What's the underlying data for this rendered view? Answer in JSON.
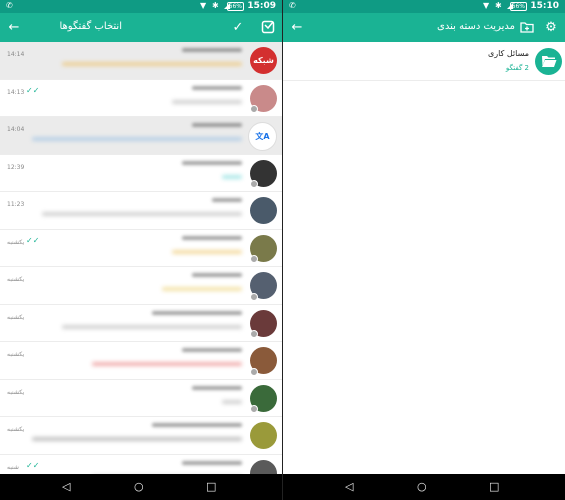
{
  "left_screen": {
    "status": {
      "time": "15:09",
      "battery": "66%"
    },
    "appbar": {
      "title": "انتخاب گفتگوها"
    },
    "rows": [
      {
        "time": "14:14",
        "ticks": "",
        "selected": true,
        "avatar_color": "#d32f2f",
        "avatar_text": "شبکه",
        "w1": 60,
        "w2": 180,
        "dot": false,
        "c2": "#f0b030"
      },
      {
        "time": "14:13",
        "ticks": "✓✓",
        "selected": false,
        "avatar_color": "#c98a8a",
        "avatar_text": "",
        "w1": 50,
        "w2": 70,
        "dot": true,
        "c2": "#999"
      },
      {
        "time": "14:04",
        "ticks": "",
        "selected": true,
        "avatar_color": "#ffffff",
        "avatar_text": "文A",
        "w1": 50,
        "w2": 210,
        "dot": false,
        "c2": "#7ab0e0"
      },
      {
        "time": "12:39",
        "ticks": "",
        "selected": false,
        "avatar_color": "#333333",
        "avatar_text": "",
        "w1": 60,
        "w2": 20,
        "dot": true,
        "c2": "#4cc"
      },
      {
        "time": "11:23",
        "ticks": "",
        "selected": false,
        "avatar_color": "#4a5a6a",
        "avatar_text": "",
        "w1": 30,
        "w2": 200,
        "dot": false,
        "c2": "#999"
      },
      {
        "time": "یکشنبه",
        "ticks": "✓✓",
        "selected": false,
        "avatar_color": "#7a7a4a",
        "avatar_text": "",
        "w1": 60,
        "w2": 70,
        "dot": true,
        "c2": "#e6b030"
      },
      {
        "time": "یکشنبه",
        "ticks": "",
        "selected": false,
        "avatar_color": "#556070",
        "avatar_text": "",
        "w1": 50,
        "w2": 80,
        "dot": true,
        "c2": "#e6c040"
      },
      {
        "time": "یکشنبه",
        "ticks": "",
        "selected": false,
        "avatar_color": "#6a3a3a",
        "avatar_text": "",
        "w1": 90,
        "w2": 180,
        "dot": true,
        "c2": "#999"
      },
      {
        "time": "یکشنبه",
        "ticks": "",
        "selected": false,
        "avatar_color": "#8a5a3a",
        "avatar_text": "",
        "w1": 60,
        "w2": 150,
        "dot": true,
        "c2": "#e05050"
      },
      {
        "time": "یکشنبه",
        "ticks": "",
        "selected": false,
        "avatar_color": "#3a6a3a",
        "avatar_text": "",
        "w1": 50,
        "w2": 20,
        "dot": true,
        "c2": "#999"
      },
      {
        "time": "یکشنبه",
        "ticks": "",
        "selected": false,
        "avatar_color": "#9a9a3a",
        "avatar_text": "",
        "w1": 90,
        "w2": 210,
        "dot": false,
        "c2": "#777"
      },
      {
        "time": "شنبه",
        "ticks": "✓✓",
        "selected": false,
        "avatar_color": "#5a5a5a",
        "avatar_text": "",
        "w1": 60,
        "w2": 150,
        "dot": true,
        "c2": "#999"
      }
    ]
  },
  "right_screen": {
    "status": {
      "time": "15:10",
      "battery": "66%"
    },
    "appbar": {
      "title": "مدیریت دسته بندی"
    },
    "folder": {
      "name": "مسائل کاری",
      "count": "2 گفتگو"
    }
  },
  "colors": {
    "primary": "#1ab394",
    "primary_dark": "#0f9b84",
    "accent": "#1ab394"
  }
}
